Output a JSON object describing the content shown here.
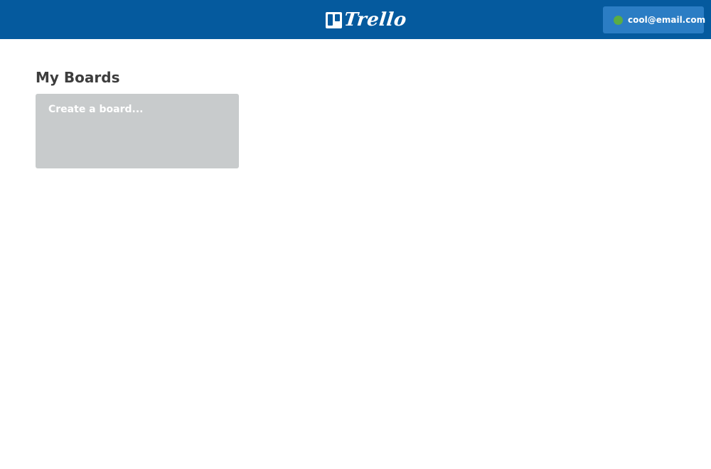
{
  "header": {
    "logo_text": "Trello",
    "logo_icon": "trello-board-icon",
    "account": {
      "email": "cool@email.com",
      "status_icon": "online-status-dot",
      "status_color": "#5aac44"
    },
    "background_color": "#055a9e"
  },
  "main": {
    "title": "My Boards",
    "create_board_label": "Create a board..."
  }
}
